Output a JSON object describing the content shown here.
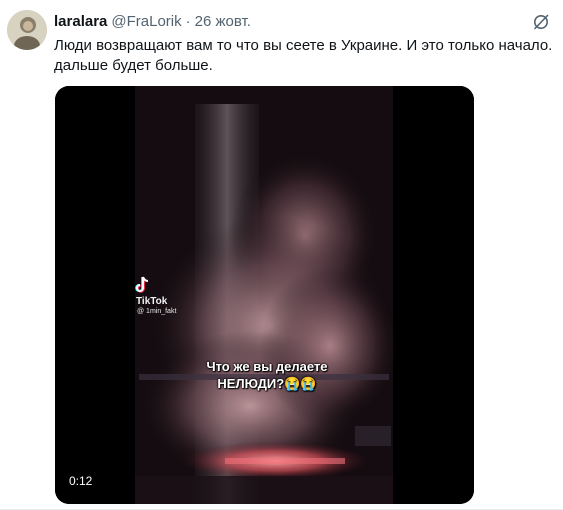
{
  "tweet": {
    "display_name": "laralara",
    "handle": "@FraLorik",
    "separator": "·",
    "time": "26 жовт.",
    "text_line1": "Люди возвращают вам то что вы сеете в Украине. И это только начало.",
    "text_line2": "дальше будет больше.",
    "more_icon": "grok-icon"
  },
  "video": {
    "watermark_brand": "TikTok",
    "watermark_user": "@ 1min_fakt",
    "caption_line1": "Что же вы делаете",
    "caption_line2": "НЕЛЮДИ?😭😭",
    "duration": "0:12"
  },
  "colors": {
    "text": "#0f1419",
    "secondary": "#536471",
    "background": "#ffffff"
  }
}
